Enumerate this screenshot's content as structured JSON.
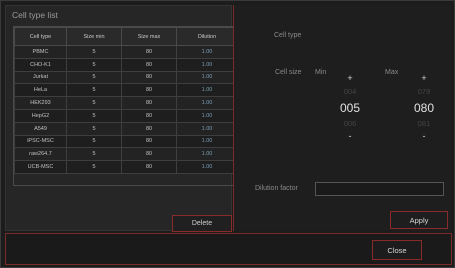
{
  "left": {
    "title": "Cell type list",
    "columns": [
      "Cell type",
      "Size min",
      "Size max",
      "Dilution"
    ],
    "rows": [
      [
        "PBMC",
        "5",
        "80",
        "1.00"
      ],
      [
        "CHO-K1",
        "5",
        "80",
        "1.00"
      ],
      [
        "Jurkat",
        "5",
        "80",
        "1.00"
      ],
      [
        "HeLa",
        "5",
        "80",
        "1.00"
      ],
      [
        "HEK293",
        "5",
        "80",
        "1.00"
      ],
      [
        "HepG2",
        "5",
        "80",
        "1.00"
      ],
      [
        "A549",
        "5",
        "80",
        "1.00"
      ],
      [
        "iPSC-MSC",
        "5",
        "80",
        "1.00"
      ],
      [
        "raw264.7",
        "5",
        "80",
        "1.00"
      ],
      [
        "UCB-MSC",
        "5",
        "80",
        "1.00"
      ]
    ],
    "delete_label": "Delete"
  },
  "right": {
    "cell_type_label": "Cell type",
    "cell_size_label": "Cell size",
    "min_label": "Min",
    "max_label": "Max",
    "min_spinner": {
      "prev": "004",
      "current": "005",
      "next": "006"
    },
    "max_spinner": {
      "prev": "079",
      "current": "080",
      "next": "081"
    },
    "plus_symbol": "+",
    "minus_symbol": "-",
    "dilution_label": "Dilution factor",
    "dilution_value": "",
    "apply_label": "Apply"
  },
  "footer": {
    "close_label": "Close"
  }
}
